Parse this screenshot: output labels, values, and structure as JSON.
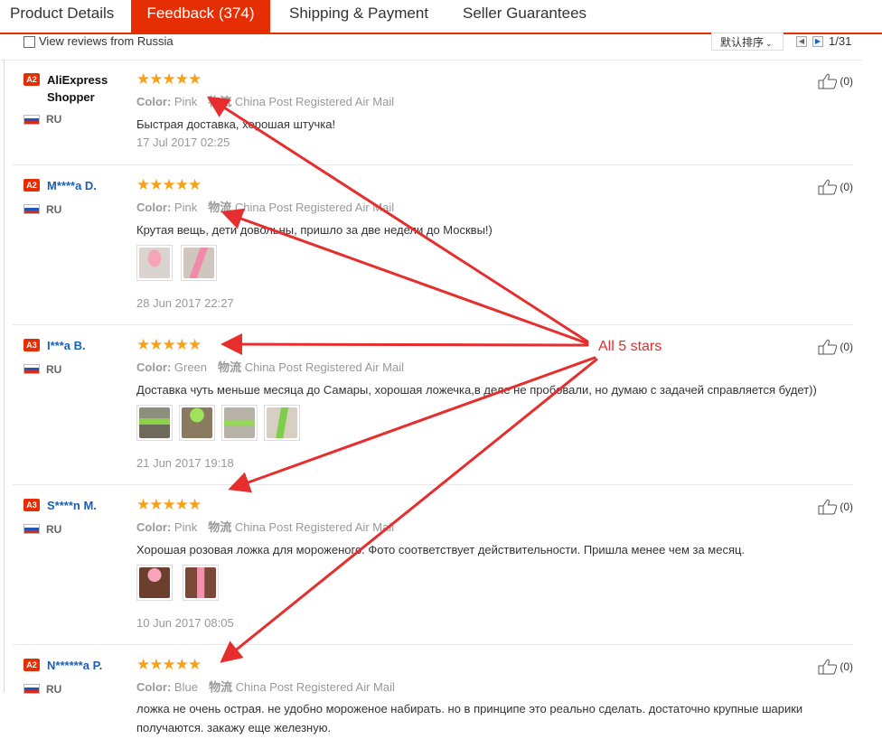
{
  "tabs": [
    {
      "label": "Product Details",
      "active": false
    },
    {
      "label": "Feedback (374)",
      "active": true
    },
    {
      "label": "Shipping & Payment",
      "active": false
    },
    {
      "label": "Seller Guarantees",
      "active": false
    }
  ],
  "toolbar": {
    "filter_label": "View reviews from Russia",
    "sort_label": "默认排序",
    "pagination": "1/31"
  },
  "reviews": [
    {
      "badge": "A2",
      "name": "AliExpress Shopper",
      "country": "RU",
      "stars": "★★★★★",
      "color_label": "Color:",
      "color": "Pink",
      "ship_label": "物流",
      "ship": "China Post Registered Air Mail",
      "text": "Быстрая доставка, хорошая штучка!",
      "date": "17 Jul 2017 02:25",
      "likes": "(0)"
    },
    {
      "badge": "A2",
      "name": "M****a D.",
      "country": "RU",
      "stars": "★★★★★",
      "color_label": "Color:",
      "color": "Pink",
      "ship_label": "物流",
      "ship": "China Post Registered Air Mail",
      "text": "Крутая вещь, дети довольны, пришло за две недели до Москвы!)",
      "date": "28 Jun 2017 22:27",
      "likes": "(0)"
    },
    {
      "badge": "A3",
      "name": "I***a B.",
      "country": "RU",
      "stars": "★★★★★",
      "color_label": "Color:",
      "color": "Green",
      "ship_label": "物流",
      "ship": "China Post Registered Air Mail",
      "text": "Доставка чуть меньше месяца до Самары, хорошая ложечка,в деле не пробовали, но думаю с задачей справляется будет))",
      "date": "21 Jun 2017 19:18",
      "likes": "(0)"
    },
    {
      "badge": "A3",
      "name": "S****n M.",
      "country": "RU",
      "stars": "★★★★★",
      "color_label": "Color:",
      "color": "Pink",
      "ship_label": "物流",
      "ship": "China Post Registered Air Mail",
      "text": "Хорошая розовая ложка для мороженого. Фото соответствует действительности. Пришла менее чем за месяц.",
      "date": "10 Jun 2017 08:05",
      "likes": "(0)"
    },
    {
      "badge": "A2",
      "name": "N******a P.",
      "country": "RU",
      "stars": "★★★★★",
      "color_label": "Color:",
      "color": "Blue",
      "ship_label": "物流",
      "ship": "China Post Registered Air Mail",
      "text": "ложка не очень острая. не удобно мороженое набирать. но в принципе это реально сделать. достаточно крупные шарики получаются. закажу еще железную.",
      "date": "",
      "likes": "(0)"
    }
  ],
  "annotation": {
    "text": "All 5 stars",
    "color": "#e62e2e"
  },
  "colors": {
    "accent": "#e62e04",
    "star": "#f7a11b",
    "link": "#1760b6"
  }
}
